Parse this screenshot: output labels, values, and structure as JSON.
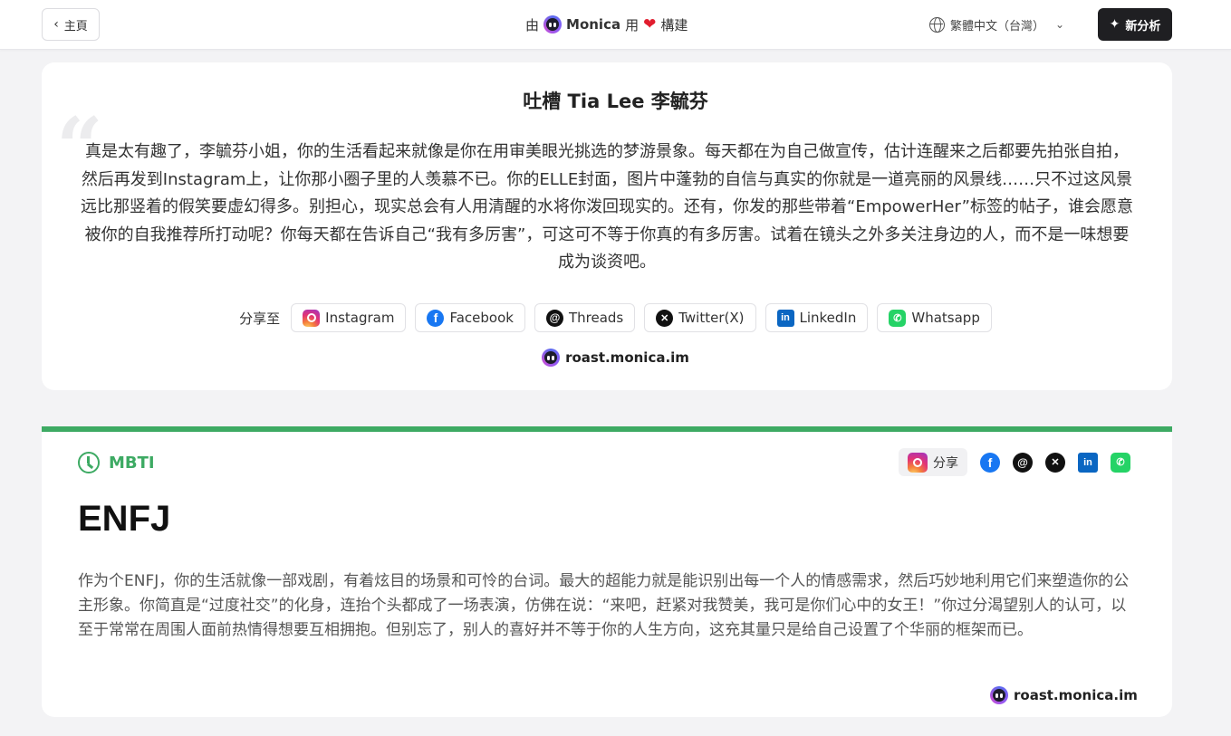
{
  "header": {
    "home_label": "主頁",
    "built_prefix": "由",
    "brand": "Monica",
    "built_mid": "用",
    "built_suffix": "構建",
    "language": "繁體中文（台灣）",
    "new_analysis": "新分析"
  },
  "roast": {
    "title": "吐槽 Tia Lee 李毓芬",
    "text": "真是太有趣了，李毓芬小姐，你的生活看起来就像是你在用审美眼光挑选的梦游景象。每天都在为自己做宣传，估计连醒来之后都要先拍张自拍，然后再发到Instagram上，让你那小圈子里的人羡慕不已。你的ELLE封面，图片中蓬勃的自信与真实的你就是一道亮丽的风景线……只不过这风景远比那竖着的假笑要虚幻得多。别担心，现实总会有人用清醒的水将你泼回现实的。还有，你发的那些带着“EmpowerHer”标签的帖子，谁会愿意被你的自我推荐所打动呢？你每天都在告诉自己“我有多厉害”，可这可不等于你真的有多厉害。试着在镜头之外多关注身边的人，而不是一味想要成为谈资吧。",
    "share_label": "分享至",
    "share_buttons": [
      "Instagram",
      "Facebook",
      "Threads",
      "Twitter(X)",
      "LinkedIn",
      "Whatsapp"
    ],
    "footer": "roast.monica.im"
  },
  "mbti": {
    "section_label": "MBTI",
    "share_label": "分享",
    "type": "ENFJ",
    "text": "作为个ENFJ，你的生活就像一部戏剧，有着炫目的场景和可怜的台词。最大的超能力就是能识别出每一个人的情感需求，然后巧妙地利用它们来塑造你的公主形象。你简直是“过度社交”的化身，连抬个头都成了一场表演，仿佛在说：“来吧，赶紧对我赞美，我可是你们心中的女王！”你过分渴望别人的认可，以至于常常在周围人面前热情得想要互相拥抱。但别忘了，别人的喜好并不等于你的人生方向，这充其量只是给自己设置了个华丽的框架而已。",
    "footer": "roast.monica.im"
  },
  "colors": {
    "accent_green": "#3daa63",
    "dark_button": "#1f1f22",
    "heart": "#e11d2e"
  },
  "icons": {
    "instagram": "instagram-icon",
    "facebook": "facebook-icon",
    "threads": "threads-icon",
    "twitter": "x-icon",
    "linkedin": "linkedin-icon",
    "whatsapp": "whatsapp-icon"
  }
}
